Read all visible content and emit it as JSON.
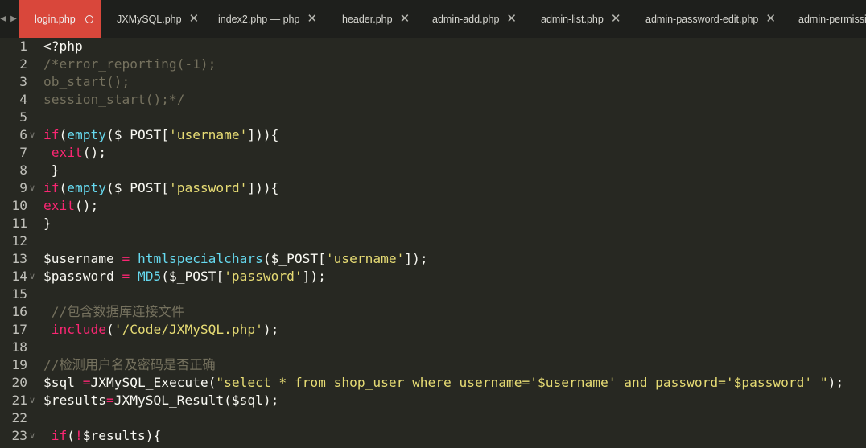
{
  "nav_arrows": "◀ ▶",
  "tabs": [
    {
      "label": "login.php",
      "active": true
    },
    {
      "label": "JXMySQL.php",
      "active": false
    },
    {
      "label": "index2.php — php",
      "active": false
    },
    {
      "label": "header.php",
      "active": false
    },
    {
      "label": "admin-add.php",
      "active": false
    },
    {
      "label": "admin-list.php",
      "active": false
    },
    {
      "label": "admin-password-edit.php",
      "active": false
    },
    {
      "label": "admin-permissi",
      "active": false
    }
  ],
  "icons": {
    "close": "✕",
    "fold": "∨"
  },
  "lines": [
    {
      "n": "1",
      "fold": false,
      "tokens": [
        [
          "pl",
          "<?php"
        ]
      ]
    },
    {
      "n": "2",
      "fold": false,
      "tokens": [
        [
          "cm",
          "/*error_reporting(-1);"
        ]
      ]
    },
    {
      "n": "3",
      "fold": false,
      "tokens": [
        [
          "cm",
          "ob_start();"
        ]
      ]
    },
    {
      "n": "4",
      "fold": false,
      "tokens": [
        [
          "cm",
          "session_start();*/"
        ]
      ]
    },
    {
      "n": "5",
      "fold": false,
      "tokens": []
    },
    {
      "n": "6",
      "fold": true,
      "tokens": [
        [
          "kw",
          "if"
        ],
        [
          "pl",
          "("
        ],
        [
          "fn",
          "empty"
        ],
        [
          "pl",
          "($_POST["
        ],
        [
          "str",
          "'username'"
        ],
        [
          "pl",
          "])){"
        ]
      ]
    },
    {
      "n": "7",
      "fold": false,
      "tokens": [
        [
          "pl",
          " "
        ],
        [
          "kw",
          "exit"
        ],
        [
          "pl",
          "();"
        ]
      ]
    },
    {
      "n": "8",
      "fold": false,
      "tokens": [
        [
          "pl",
          " }"
        ]
      ]
    },
    {
      "n": "9",
      "fold": true,
      "tokens": [
        [
          "kw",
          "if"
        ],
        [
          "pl",
          "("
        ],
        [
          "fn",
          "empty"
        ],
        [
          "pl",
          "($_POST["
        ],
        [
          "str",
          "'password'"
        ],
        [
          "pl",
          "])){"
        ]
      ]
    },
    {
      "n": "10",
      "fold": false,
      "tokens": [
        [
          "kw",
          "exit"
        ],
        [
          "pl",
          "();"
        ]
      ]
    },
    {
      "n": "11",
      "fold": false,
      "tokens": [
        [
          "pl",
          "}"
        ]
      ]
    },
    {
      "n": "12",
      "fold": false,
      "tokens": []
    },
    {
      "n": "13",
      "fold": false,
      "tokens": [
        [
          "pl",
          "$username "
        ],
        [
          "kw",
          "="
        ],
        [
          "pl",
          " "
        ],
        [
          "fn",
          "htmlspecialchars"
        ],
        [
          "pl",
          "($_POST["
        ],
        [
          "str",
          "'username'"
        ],
        [
          "pl",
          "]);"
        ]
      ]
    },
    {
      "n": "14",
      "fold": true,
      "tokens": [
        [
          "pl",
          "$password "
        ],
        [
          "kw",
          "="
        ],
        [
          "pl",
          " "
        ],
        [
          "fn",
          "MD5"
        ],
        [
          "pl",
          "($_POST["
        ],
        [
          "str",
          "'password'"
        ],
        [
          "pl",
          "]);"
        ]
      ]
    },
    {
      "n": "15",
      "fold": false,
      "tokens": []
    },
    {
      "n": "16",
      "fold": false,
      "tokens": [
        [
          "pl",
          " "
        ],
        [
          "cm",
          "//包含数据库连接文件"
        ]
      ]
    },
    {
      "n": "17",
      "fold": false,
      "tokens": [
        [
          "pl",
          " "
        ],
        [
          "kw",
          "include"
        ],
        [
          "pl",
          "("
        ],
        [
          "str",
          "'/Code/JXMySQL.php'"
        ],
        [
          "pl",
          ");"
        ]
      ]
    },
    {
      "n": "18",
      "fold": false,
      "tokens": []
    },
    {
      "n": "19",
      "fold": false,
      "tokens": [
        [
          "cm",
          "//检测用户名及密码是否正确"
        ]
      ]
    },
    {
      "n": "20",
      "fold": false,
      "tokens": [
        [
          "pl",
          "$sql "
        ],
        [
          "kw",
          "="
        ],
        [
          "pl",
          "JXMySQL_Execute("
        ],
        [
          "str",
          "\"select * from shop_user where username='$username' and password='$password' \""
        ],
        [
          "pl",
          ");"
        ]
      ]
    },
    {
      "n": "21",
      "fold": true,
      "tokens": [
        [
          "pl",
          "$results"
        ],
        [
          "kw",
          "="
        ],
        [
          "pl",
          "JXMySQL_Result($sql);"
        ]
      ]
    },
    {
      "n": "22",
      "fold": false,
      "tokens": []
    },
    {
      "n": "23",
      "fold": true,
      "tokens": [
        [
          "pl",
          " "
        ],
        [
          "kw",
          "if"
        ],
        [
          "pl",
          "("
        ],
        [
          "kw",
          "!"
        ],
        [
          "pl",
          "$results){"
        ]
      ]
    }
  ]
}
